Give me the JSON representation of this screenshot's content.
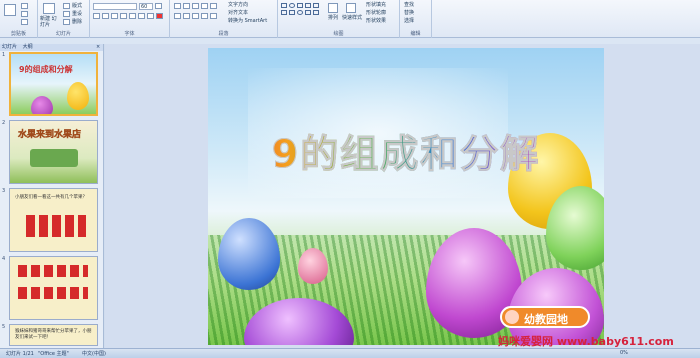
{
  "ribbon": {
    "groups": [
      "剪贴板",
      "幻灯片",
      "字体",
      "段落",
      "绘图",
      "编辑"
    ],
    "slides_group": {
      "new_slide": "新建 幻灯片",
      "layout": "版式",
      "reset": "重设",
      "delete": "删除"
    },
    "paragraph": {
      "text_direction": "文字方向",
      "align_text": "对齐文本",
      "smartart": "转换为 SmartArt"
    },
    "drawing": {
      "arrange": "排列",
      "quick_styles": "快速样式",
      "fill": "形状填充",
      "outline": "形状轮廓",
      "effects": "形状效果"
    },
    "editing": {
      "find": "查找",
      "replace": "替换",
      "select": "选择"
    },
    "font_size": "60"
  },
  "panel": {
    "tab_slides": "幻灯片",
    "tab_outline": "大纲",
    "close": "×"
  },
  "thumbs": [
    {
      "num": "1",
      "title": "9的组成和分解"
    },
    {
      "num": "2",
      "title": "水果来到水果店"
    },
    {
      "num": "3",
      "text": "小朋友们看一看这一共有几个苹果？"
    },
    {
      "num": "4"
    },
    {
      "num": "5",
      "text": "猴妹妹和猪哥哥来帮忙分苹果了，小朋友们来试一下吧！"
    }
  ],
  "slide": {
    "title": "9的组成和分解",
    "logo": "幼教园地"
  },
  "status": {
    "slide_of": "幻灯片 1/21",
    "theme": "\"Office 主题\"",
    "language": "中文(中国)",
    "zoom": "0%"
  },
  "watermark": "妈咪爱婴网 www.baby611.com",
  "colors": {
    "accent": "#2b579a",
    "title_gradient": [
      "#e7323a",
      "#f4a01e",
      "#4db43d",
      "#2f7fd8",
      "#a53cc4"
    ]
  }
}
